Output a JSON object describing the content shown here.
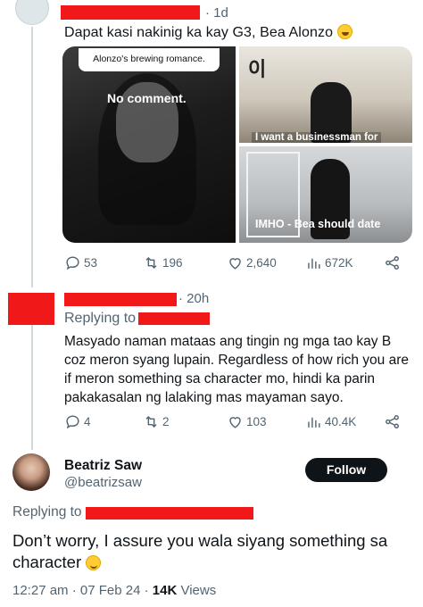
{
  "tweet1": {
    "time": "· 1d",
    "text": "Dapat kasi nakinig ka kay G3, Bea Alonzo",
    "emoji": "grinning-emoji",
    "media": {
      "left_card_text": "Alonzo's brewing romance.",
      "left_caption": "No comment.",
      "top_right_sign": "이",
      "top_right_caption": "I want a businessman for",
      "bottom_right_caption": "IMHO - Bea should date"
    },
    "stats": {
      "replies": "53",
      "retweets": "196",
      "likes": "2,640",
      "views": "672K"
    }
  },
  "tweet2": {
    "time": "· 20h",
    "replying_to": "Replying to",
    "text": "Masyado naman mataas ang tingin ng mga tao kay B coz meron syang lupain. Regardless of how rich you are if meron something sa character mo, hindi ka parin pakakasalan ng lalaking mas mayaman sayo.",
    "stats": {
      "replies": "4",
      "retweets": "2",
      "likes": "103",
      "views": "40.4K"
    }
  },
  "tweet3": {
    "name": "Beatriz Saw",
    "handle": "@beatrizsaw",
    "follow_label": "Follow",
    "replying_to": "Replying to",
    "text": "Don’t worry, I assure you wala siyang something sa character",
    "emoji": "winking-emoji",
    "timestamp": "12:27 am · 07 Feb 24 · ",
    "views_count": "14K",
    "views_label": " Views"
  },
  "colors": {
    "redaction": "#f01818",
    "muted": "#536471",
    "text": "#0f1419",
    "thread": "#cfd9de"
  }
}
